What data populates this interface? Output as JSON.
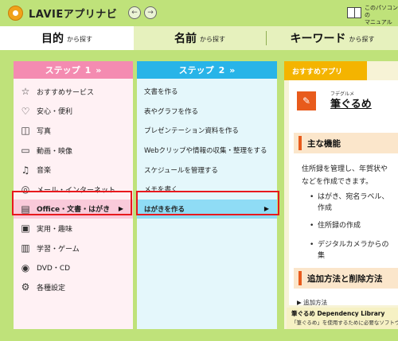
{
  "app": {
    "title": "LAVIEアプリナビ",
    "manual_line1": "このパソコンの",
    "manual_line2": "マニュアル"
  },
  "nav": {
    "back": "←",
    "forward": "→"
  },
  "tabs": [
    {
      "main": "目的",
      "sub": "から探す",
      "active": true
    },
    {
      "main": "名前",
      "sub": "から探す",
      "active": false
    },
    {
      "main": "キーワード",
      "sub": "から探す",
      "active": false
    }
  ],
  "step1": {
    "label": "ステップ",
    "number": "1",
    "chevron": "»",
    "items": [
      {
        "label": "おすすめサービス",
        "icon": "star-icon",
        "glyph": "☆"
      },
      {
        "label": "安心・便利",
        "icon": "heart-icon",
        "glyph": "♡"
      },
      {
        "label": "写真",
        "icon": "camera-icon",
        "glyph": "◫"
      },
      {
        "label": "動画・映像",
        "icon": "video-icon",
        "glyph": "▭"
      },
      {
        "label": "音楽",
        "icon": "music-note-icon",
        "glyph": "♫"
      },
      {
        "label": "メール・インターネット",
        "icon": "globe-icon",
        "glyph": "◎"
      },
      {
        "label": "Office・文書・はがき",
        "icon": "book-icon",
        "glyph": "▤",
        "selected": true
      },
      {
        "label": "実用・趣味",
        "icon": "toolbox-icon",
        "glyph": "▣"
      },
      {
        "label": "学習・ゲーム",
        "icon": "book-open-icon",
        "glyph": "▥"
      },
      {
        "label": "DVD・CD",
        "icon": "disc-icon",
        "glyph": "◉"
      },
      {
        "label": "各種設定",
        "icon": "gear-icon",
        "glyph": "⚙"
      }
    ]
  },
  "step2": {
    "label": "ステップ",
    "number": "2",
    "chevron": "»",
    "items": [
      {
        "label": "文書を作る"
      },
      {
        "label": "表やグラフを作る"
      },
      {
        "label": "プレゼンテーション資料を作る"
      },
      {
        "label": "Webクリップや情報の収集・整理をする"
      },
      {
        "label": "スケジュールを管理する"
      },
      {
        "label": "メモを書く"
      },
      {
        "label": "はがきを作る",
        "selected": true
      }
    ]
  },
  "arrow": "▶",
  "recommend": {
    "tab": "おすすめアプリ",
    "app_ruby": "フデグルメ",
    "app_name": "筆ぐるめ",
    "section_features": "主な機能",
    "desc_line1": "住所録を管理し、年賀状や",
    "desc_line2": "などを作成できます。",
    "bullets": [
      {
        "line1": "はがき、宛名ラベル、",
        "line2": "作成"
      },
      {
        "line1": "住所録の作成",
        "line2": ""
      },
      {
        "line1": "デジタルカメラからの",
        "line2": "集"
      }
    ],
    "bullet_dot": "•",
    "section_addremove": "追加方法と削除方法",
    "link": "▶ 追加方法",
    "footer_title": "筆ぐるめ Dependency Library",
    "footer_desc": "「筆ぐるめ」を使用するために必要なソフトウェアです"
  }
}
